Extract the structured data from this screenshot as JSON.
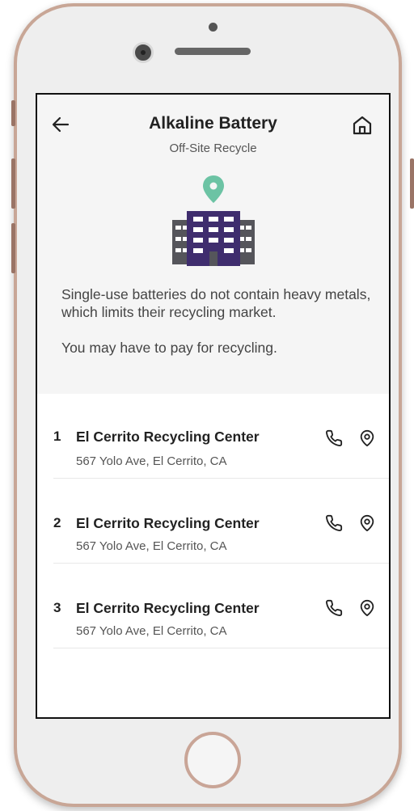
{
  "header": {
    "title": "Alkaline Battery",
    "subtitle": "Off-Site Recycle",
    "back_icon": "arrow-left-icon",
    "home_icon": "home-icon"
  },
  "info": {
    "description": "Single-use batteries do not contain heavy metals, which limits their recycling market.",
    "note": "You may have to pay for recycling."
  },
  "locations": [
    {
      "number": "1",
      "name": "El Cerrito Recycling Center",
      "address": "567 Yolo Ave, El Cerrito, CA"
    },
    {
      "number": "2",
      "name": "El Cerrito Recycling Center",
      "address": "567 Yolo Ave, El Cerrito, CA"
    },
    {
      "number": "3",
      "name": "El Cerrito Recycling Center",
      "address": "567 Yolo Ave, El Cerrito, CA"
    }
  ],
  "colors": {
    "pin": "#6cc3a4",
    "building": "#3f2d6e",
    "building_side": "#55555b"
  }
}
